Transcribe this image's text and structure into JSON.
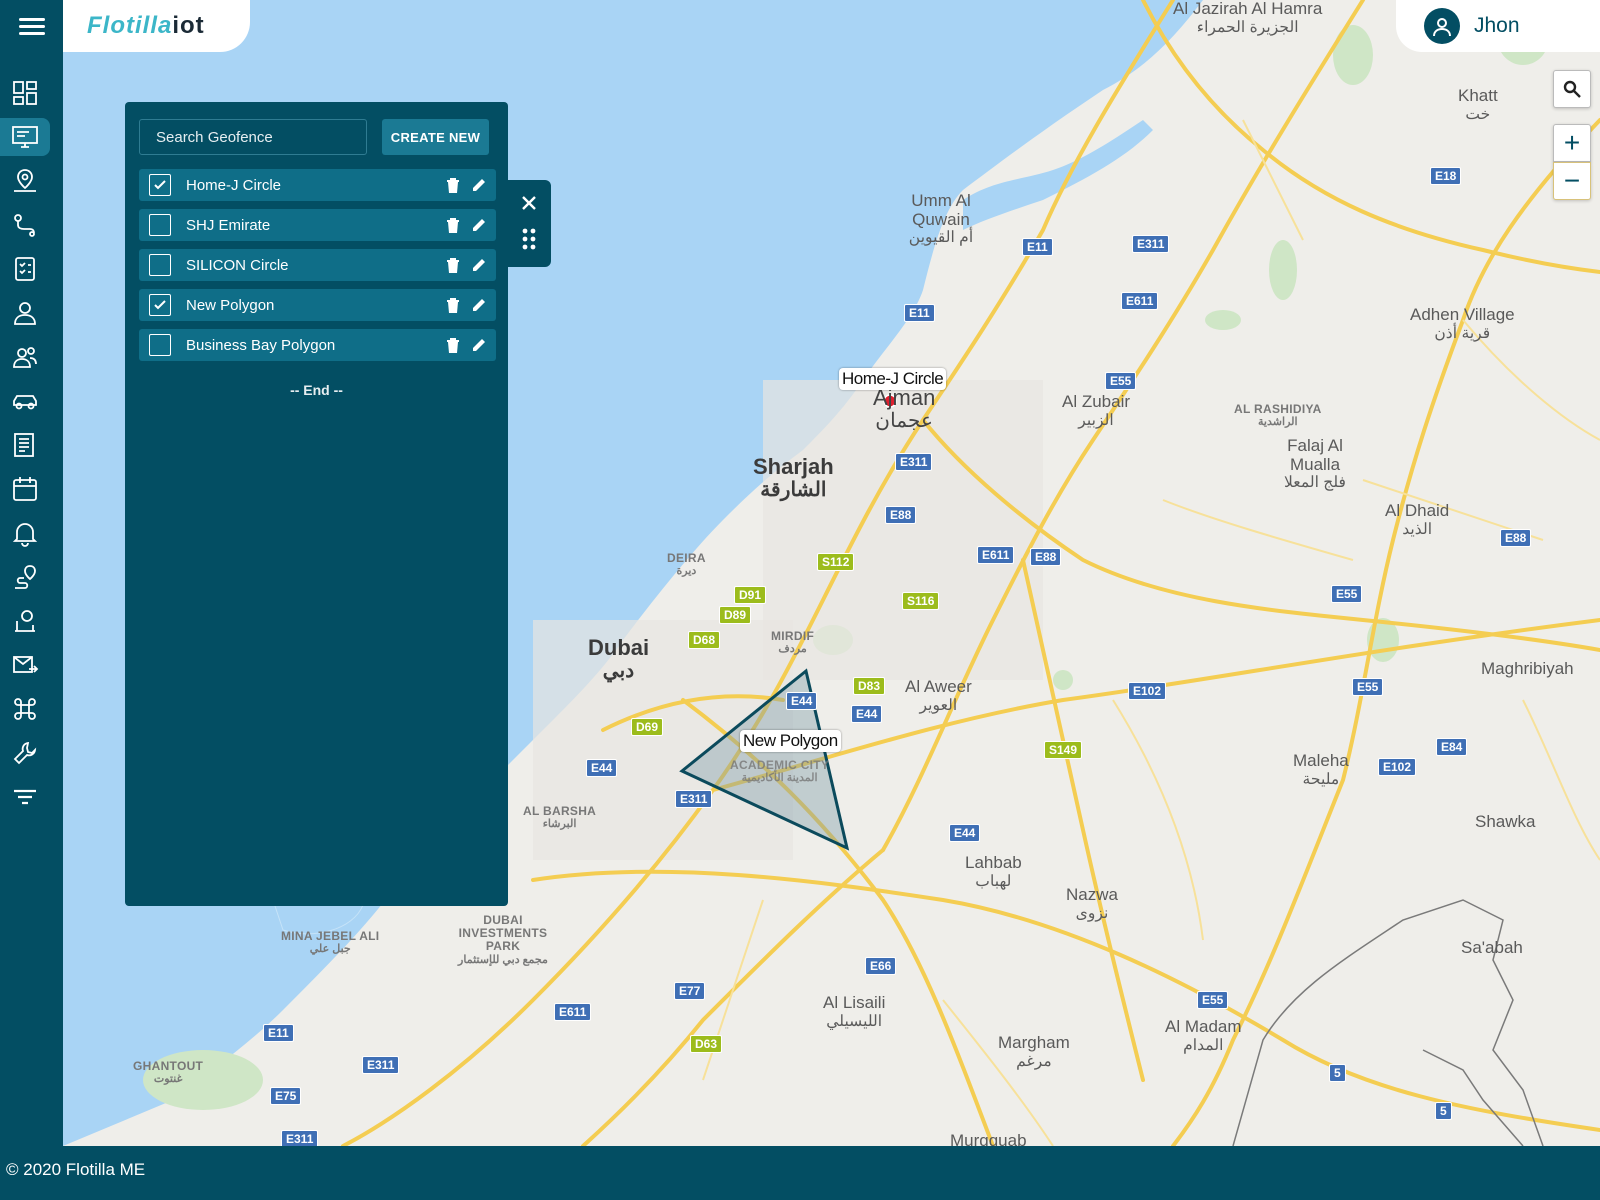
{
  "app": {
    "logo_text": "Flotilla",
    "logo_suffix": "iot"
  },
  "user": {
    "name": "Jhon"
  },
  "footer": {
    "copyright": "© 2020 Flotilla ME"
  },
  "sidebar": {
    "items": [
      {
        "icon": "dashboard-icon",
        "label": "Dashboard"
      },
      {
        "icon": "monitor-icon",
        "label": "Live Tracking",
        "active": true
      },
      {
        "icon": "map-pin-icon",
        "label": "Geofence"
      },
      {
        "icon": "route-icon",
        "label": "Routes"
      },
      {
        "icon": "checklist-icon",
        "label": "Tasks"
      },
      {
        "icon": "user-icon",
        "label": "Drivers"
      },
      {
        "icon": "users-icon",
        "label": "Users"
      },
      {
        "icon": "car-icon",
        "label": "Vehicles"
      },
      {
        "icon": "report-icon",
        "label": "Reports"
      },
      {
        "icon": "calendar-icon",
        "label": "Calendar"
      },
      {
        "icon": "bell-icon",
        "label": "Alerts"
      },
      {
        "icon": "trip-icon",
        "label": "Trips"
      },
      {
        "icon": "support-icon",
        "label": "Support"
      },
      {
        "icon": "mail-forward-icon",
        "label": "Messages"
      },
      {
        "icon": "command-icon",
        "label": "Commands"
      },
      {
        "icon": "wrench-icon",
        "label": "Maintenance"
      },
      {
        "icon": "filter-icon",
        "label": "Filters"
      }
    ]
  },
  "geofence_panel": {
    "search_placeholder": "Search Geofence",
    "create_label": "CREATE NEW",
    "end_label": "-- End --",
    "items": [
      {
        "name": "Home-J Circle",
        "checked": true
      },
      {
        "name": "SHJ Emirate",
        "checked": false
      },
      {
        "name": "SILICON Circle",
        "checked": false
      },
      {
        "name": "New Polygon",
        "checked": true
      },
      {
        "name": "Business Bay Polygon",
        "checked": false
      }
    ]
  },
  "map": {
    "zoom_in": "+",
    "zoom_out": "−",
    "geofence_labels": {
      "circle": "Home-J Circle",
      "polygon": "New Polygon"
    },
    "places": [
      {
        "name": "Al Jazirah Al Hamra",
        "ar": "الجزيرة الحمراء"
      },
      {
        "name": "Khatt",
        "ar": "خت"
      },
      {
        "name": "Umm Al Quwain",
        "ar": "أم القيوين"
      },
      {
        "name": "Adhen Village",
        "ar": "قرية أذن"
      },
      {
        "name": "Ajman",
        "ar": "عجمان"
      },
      {
        "name": "Al Zubair",
        "ar": "الزبير"
      },
      {
        "name": "AL RASHIDIYA",
        "ar": "الراشدية"
      },
      {
        "name": "Falaj Al Mualla",
        "ar": "فلج المعلا"
      },
      {
        "name": "Sharjah",
        "ar": "الشارقة"
      },
      {
        "name": "Al Dhaid",
        "ar": "الذيد"
      },
      {
        "name": "DEIRA",
        "ar": "ديرة"
      },
      {
        "name": "MIRDIF",
        "ar": "مردف"
      },
      {
        "name": "Dubai",
        "ar": "دبي"
      },
      {
        "name": "Al Aweer",
        "ar": "العوير"
      },
      {
        "name": "Maghribiyah",
        "ar": ""
      },
      {
        "name": "ACADEMIC CITY",
        "ar": "المدينة الأكاديمية"
      },
      {
        "name": "AL BARSHA",
        "ar": "البرشاء"
      },
      {
        "name": "Maleha",
        "ar": "مليحة"
      },
      {
        "name": "Shawka",
        "ar": ""
      },
      {
        "name": "Lahbab",
        "ar": "لهباب"
      },
      {
        "name": "Nazwa",
        "ar": "نزوى"
      },
      {
        "name": "MINA JEBEL ALI",
        "ar": "جبل علي"
      },
      {
        "name": "DUBAI INVESTMENTS PARK",
        "ar": "مجمع دبي للإستثمار"
      },
      {
        "name": "Sa'abah",
        "ar": ""
      },
      {
        "name": "Al Lisaili",
        "ar": "الليسيلي"
      },
      {
        "name": "Margham",
        "ar": "مرغم"
      },
      {
        "name": "Al Madam",
        "ar": "المدام"
      },
      {
        "name": "GHANTOUT",
        "ar": "غنتوت"
      },
      {
        "name": "Murqquab",
        "ar": ""
      }
    ],
    "shields": [
      {
        "text": "E18",
        "color": "blue"
      },
      {
        "text": "E11",
        "color": "blue"
      },
      {
        "text": "E311",
        "color": "blue"
      },
      {
        "text": "E11",
        "color": "blue"
      },
      {
        "text": "E611",
        "color": "blue"
      },
      {
        "text": "E55",
        "color": "blue"
      },
      {
        "text": "E311",
        "color": "blue"
      },
      {
        "text": "E88",
        "color": "blue"
      },
      {
        "text": "S112",
        "color": "green"
      },
      {
        "text": "E611",
        "color": "blue"
      },
      {
        "text": "E88",
        "color": "blue"
      },
      {
        "text": "E55",
        "color": "blue"
      },
      {
        "text": "E88",
        "color": "blue"
      },
      {
        "text": "D91",
        "color": "green"
      },
      {
        "text": "D89",
        "color": "green"
      },
      {
        "text": "S116",
        "color": "green"
      },
      {
        "text": "D68",
        "color": "green"
      },
      {
        "text": "D83",
        "color": "green"
      },
      {
        "text": "E44",
        "color": "blue"
      },
      {
        "text": "E44",
        "color": "blue"
      },
      {
        "text": "E102",
        "color": "blue"
      },
      {
        "text": "E55",
        "color": "blue"
      },
      {
        "text": "D69",
        "color": "green"
      },
      {
        "text": "S149",
        "color": "green"
      },
      {
        "text": "E84",
        "color": "blue"
      },
      {
        "text": "E102",
        "color": "blue"
      },
      {
        "text": "E44",
        "color": "blue"
      },
      {
        "text": "E311",
        "color": "blue"
      },
      {
        "text": "E44",
        "color": "blue"
      },
      {
        "text": "E66",
        "color": "blue"
      },
      {
        "text": "E77",
        "color": "blue"
      },
      {
        "text": "E611",
        "color": "blue"
      },
      {
        "text": "E55",
        "color": "blue"
      },
      {
        "text": "D63",
        "color": "green"
      },
      {
        "text": "E11",
        "color": "blue"
      },
      {
        "text": "E311",
        "color": "blue"
      },
      {
        "text": "E75",
        "color": "blue"
      },
      {
        "text": "E311",
        "color": "blue"
      },
      {
        "text": "5",
        "color": "blue"
      },
      {
        "text": "5",
        "color": "blue"
      }
    ]
  },
  "colors": {
    "primary": "#034e63",
    "row": "#0f6e88",
    "accent": "#1b7a94",
    "water": "#a9d4f5",
    "land": "#efeeea",
    "road": "#f7d76b"
  }
}
